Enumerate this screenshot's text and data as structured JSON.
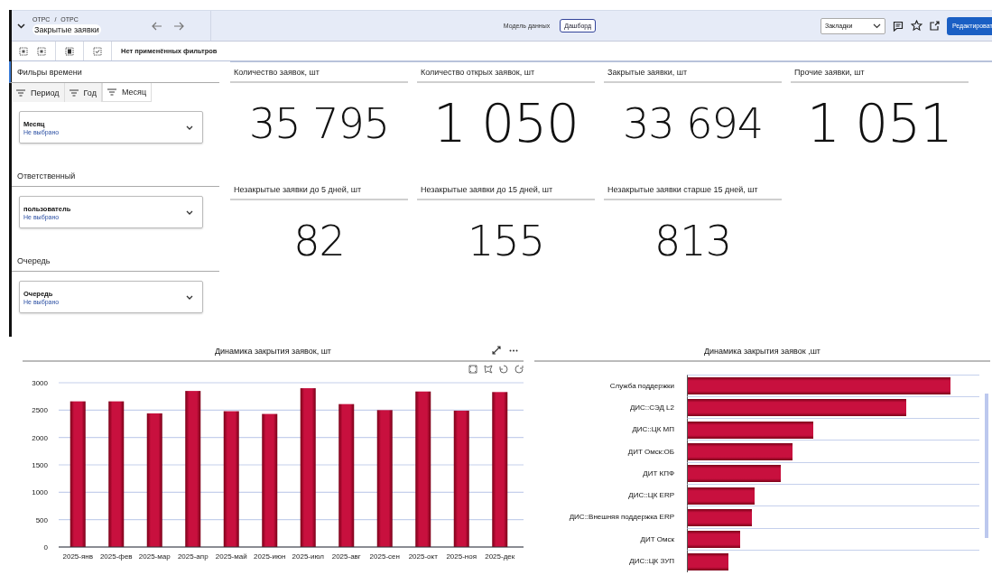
{
  "header": {
    "breadcrumbs": [
      "ОТРС",
      "ОТРС"
    ],
    "separator": "/",
    "title": "Закрытые заявки",
    "mode_tabs": [
      {
        "label": "Модель данных",
        "selected": false
      },
      {
        "label": "Дашборд",
        "selected": true
      }
    ],
    "bookmarks": {
      "value": "Закладки"
    },
    "edit_button": "Редактироват"
  },
  "toolbar": {
    "filter_status": "Нет применённых фильтров"
  },
  "filters": {
    "title": "Фильры времени",
    "tabs": [
      {
        "label": "Период",
        "selected": false
      },
      {
        "label": "Год",
        "selected": false
      },
      {
        "label": "Месяц",
        "selected": true
      }
    ],
    "sections": [
      {
        "select": {
          "label": "Месяц",
          "placeholder": "Не выбрано"
        }
      },
      {
        "title": "Ответственный",
        "select": {
          "label": "пользователь",
          "placeholder": "Не выбрано"
        }
      },
      {
        "title": "Очередь",
        "select": {
          "label": "Очередь",
          "placeholder": "Не выбрано"
        }
      }
    ]
  },
  "kpis": [
    {
      "title": "Количество заявок, шт",
      "value": "35 795"
    },
    {
      "title": "Количество открых заявок, шт",
      "value": "1 050"
    },
    {
      "title": "Закрытые заявки, шт",
      "value": "33 694"
    },
    {
      "title": "Прочие заявки, шт",
      "value": "1 051"
    },
    {
      "title": "Незакрытые заявки до 5 дней, шт",
      "value": "82"
    },
    {
      "title": "Незакрытые заявки до  15 дней, шт",
      "value": "155"
    },
    {
      "title": "Незакрытые заявки старше 15 дней, шт",
      "value": "813"
    }
  ],
  "monthly_chart": {
    "chart_data": {
      "type": "bar",
      "title": "Динамика закрытия заявок, шт",
      "categories": [
        "2025-янв",
        "2025-фев",
        "2025-мар",
        "2025-апр",
        "2025-май",
        "2025-июн",
        "2025-июл",
        "2025-авг",
        "2025-сен",
        "2025-окт",
        "2025-ноя",
        "2025-дек"
      ],
      "series": [
        {
          "color": "#c8103e",
          "values": [
            2660,
            2660,
            2440,
            2850,
            2480,
            2430,
            2900,
            2610,
            2500,
            2840,
            2490,
            2830
          ]
        }
      ],
      "ylim": [
        0,
        3000
      ],
      "grid": true,
      "yticks": [
        0,
        500,
        1000,
        1500,
        2000,
        2500,
        3000
      ]
    }
  },
  "queue_chart": {
    "title": "Динамика закрытия заявок ,шт",
    "bars": [
      {
        "label": "Служба поддержки",
        "level": 0.9
      },
      {
        "label": "ДИС::СЭД L2",
        "level": 0.75
      },
      {
        "label": "ДИС::ЦК МП",
        "level": 0.43
      },
      {
        "label": "ДИТ Омск:ОБ",
        "level": 0.36
      },
      {
        "label": "ДИТ КПФ",
        "level": 0.32
      },
      {
        "label": "ДИС::ЦК ERP",
        "level": 0.23
      },
      {
        "label": "ДИС::Внешняя поддержка ERP",
        "level": 0.22
      },
      {
        "label": "ДИТ Омск",
        "level": 0.18
      },
      {
        "label": "ДИС::ЦК ЗУП",
        "level": 0.14
      }
    ]
  }
}
